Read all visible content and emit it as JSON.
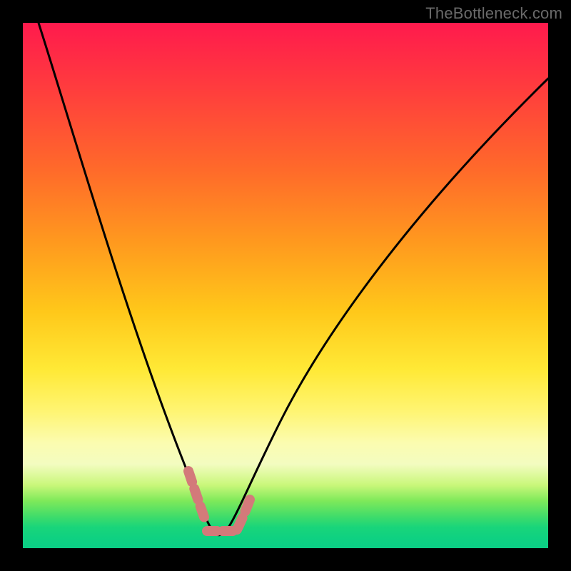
{
  "watermark": "TheBottleneck.com",
  "chart_data": {
    "type": "line",
    "title": "",
    "xlabel": "",
    "ylabel": "",
    "xlim": [
      0,
      100
    ],
    "ylim": [
      0,
      100
    ],
    "annotations": [],
    "series": [
      {
        "name": "bottleneck-curve",
        "color": "#000000",
        "x": [
          3,
          6,
          9,
          12,
          15,
          18,
          21,
          24,
          27,
          30,
          32,
          34,
          35,
          36,
          37,
          38,
          39,
          41,
          44,
          48,
          54,
          62,
          72,
          84,
          100
        ],
        "y": [
          100,
          90,
          80,
          70,
          60,
          51,
          42,
          34,
          26,
          18,
          12,
          7,
          4,
          2,
          2,
          3,
          5,
          9,
          16,
          25,
          37,
          51,
          65,
          78,
          90
        ]
      },
      {
        "name": "highlight-near-minimum",
        "color": "#d37a7a",
        "x": [
          31,
          32,
          33,
          34,
          35,
          36,
          37,
          38,
          39,
          40
        ],
        "y": [
          14,
          11,
          8,
          5,
          3,
          2,
          2,
          3,
          5,
          8
        ]
      }
    ],
    "background_gradient": {
      "top": "#ff1a4d",
      "mid": "#ffe936",
      "bottom": "#0bce85"
    }
  }
}
